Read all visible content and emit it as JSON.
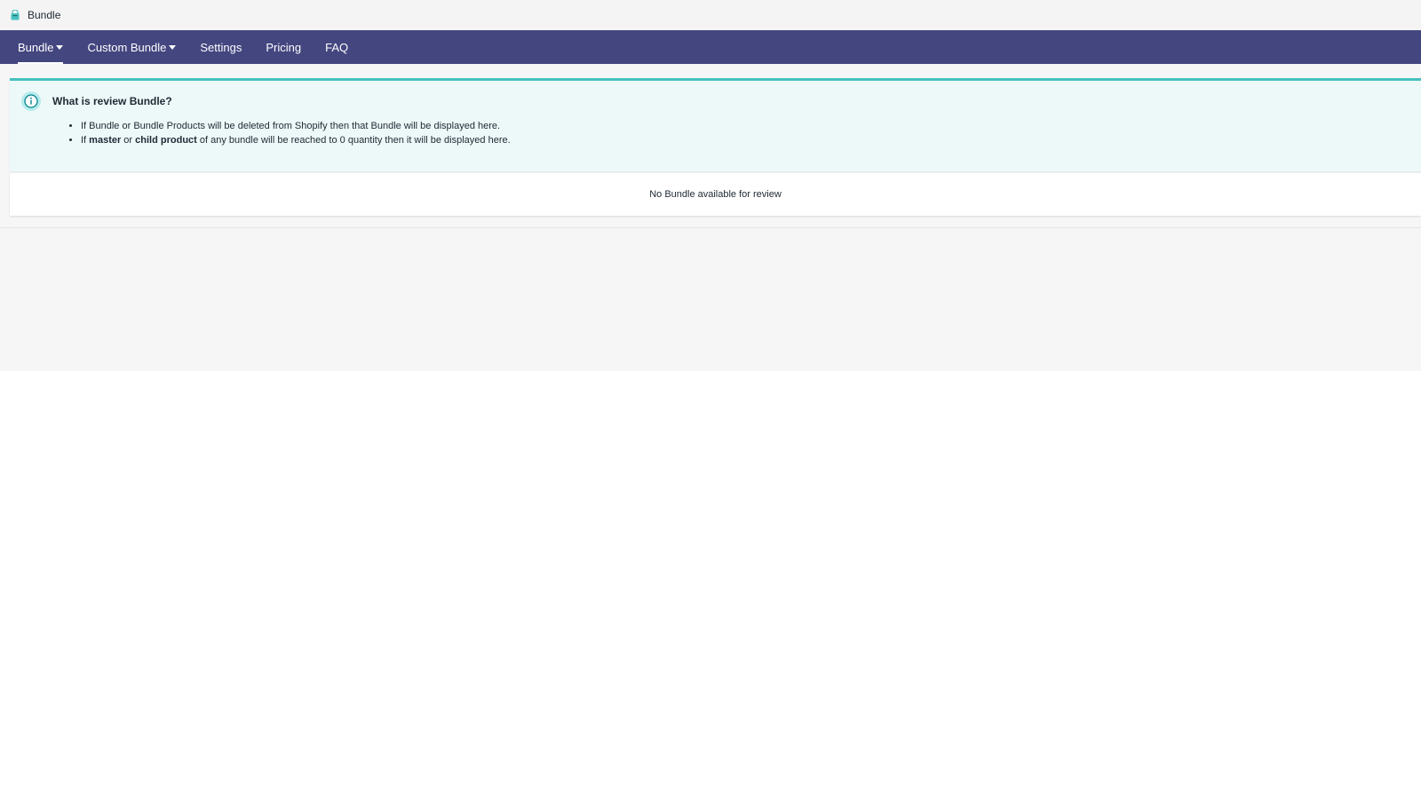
{
  "app": {
    "title": "Bundle",
    "icon": "shopping-bag-icon",
    "accent_color": "#47c1bf"
  },
  "nav": {
    "background_color": "#43467f",
    "items": [
      {
        "label": "Bundle",
        "has_dropdown": true,
        "active": true
      },
      {
        "label": "Custom Bundle",
        "has_dropdown": true,
        "active": false
      },
      {
        "label": "Settings",
        "has_dropdown": false,
        "active": false
      },
      {
        "label": "Pricing",
        "has_dropdown": false,
        "active": false
      },
      {
        "label": "FAQ",
        "has_dropdown": false,
        "active": false
      }
    ]
  },
  "banner": {
    "icon": "info-circle-icon",
    "title": "What is review Bundle?",
    "items": [
      {
        "parts": [
          {
            "text": "If Bundle or Bundle Products will be deleted from Shopify then that Bundle will be displayed here.",
            "bold": false
          }
        ]
      },
      {
        "parts": [
          {
            "text": "If ",
            "bold": false
          },
          {
            "text": "master",
            "bold": true
          },
          {
            "text": " or ",
            "bold": false
          },
          {
            "text": "child product",
            "bold": true
          },
          {
            "text": " of any bundle will be reached to 0 quantity then it will be displayed here.",
            "bold": false
          }
        ]
      }
    ]
  },
  "empty_state": {
    "message": "No Bundle available for review"
  }
}
